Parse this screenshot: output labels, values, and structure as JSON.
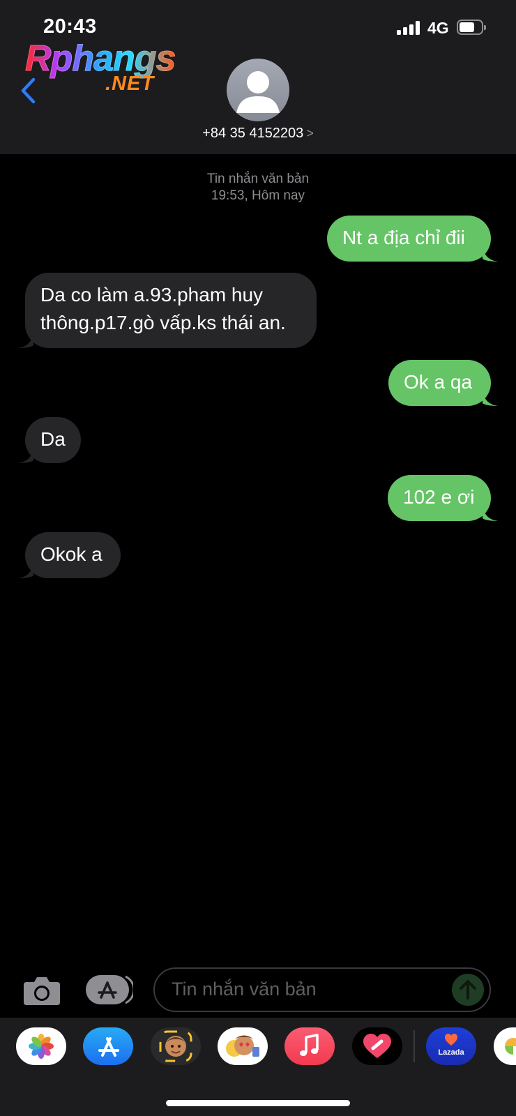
{
  "status_bar": {
    "time": "20:43",
    "network": "4G",
    "battery_level": 0.7,
    "signal_bars": 4
  },
  "watermark": {
    "main": "Rphangs",
    "sub": ".NET"
  },
  "header": {
    "contact": "+84 35 4152203",
    "chevron": ">"
  },
  "conversation": {
    "service_label": "Tin nhắn văn bản",
    "timestamp": "19:53, Hôm nay",
    "messages": [
      {
        "from": "me",
        "lines": [
          "Nt a địa chỉ đii"
        ]
      },
      {
        "from": "them",
        "lines": [
          "Da co làm a.93.pham huy",
          "thông.p17.gò vấp.ks thái an."
        ]
      },
      {
        "from": "me",
        "lines": [
          "Ok a qa"
        ]
      },
      {
        "from": "them",
        "lines": [
          "Da"
        ]
      },
      {
        "from": "me",
        "lines": [
          "102 e ơi"
        ]
      },
      {
        "from": "them",
        "lines": [
          "Okok a"
        ]
      }
    ]
  },
  "composer": {
    "placeholder": "Tin nhắn văn bản"
  },
  "app_drawer": {
    "apps": [
      {
        "icon": "photos-icon"
      },
      {
        "icon": "app-store-icon"
      },
      {
        "icon": "memoji-icon"
      },
      {
        "icon": "animoji-stickers-icon"
      },
      {
        "icon": "music-icon"
      },
      {
        "icon": "digital-touch-icon"
      },
      {
        "icon": "lazada-icon",
        "label": "Lazada"
      },
      {
        "icon": "partial-app-icon"
      }
    ]
  },
  "colors": {
    "sent_bubble": "#65c466",
    "received_bubble": "#262629",
    "header_bg": "#1c1c1e",
    "accent_blue": "#2f7cf6"
  }
}
